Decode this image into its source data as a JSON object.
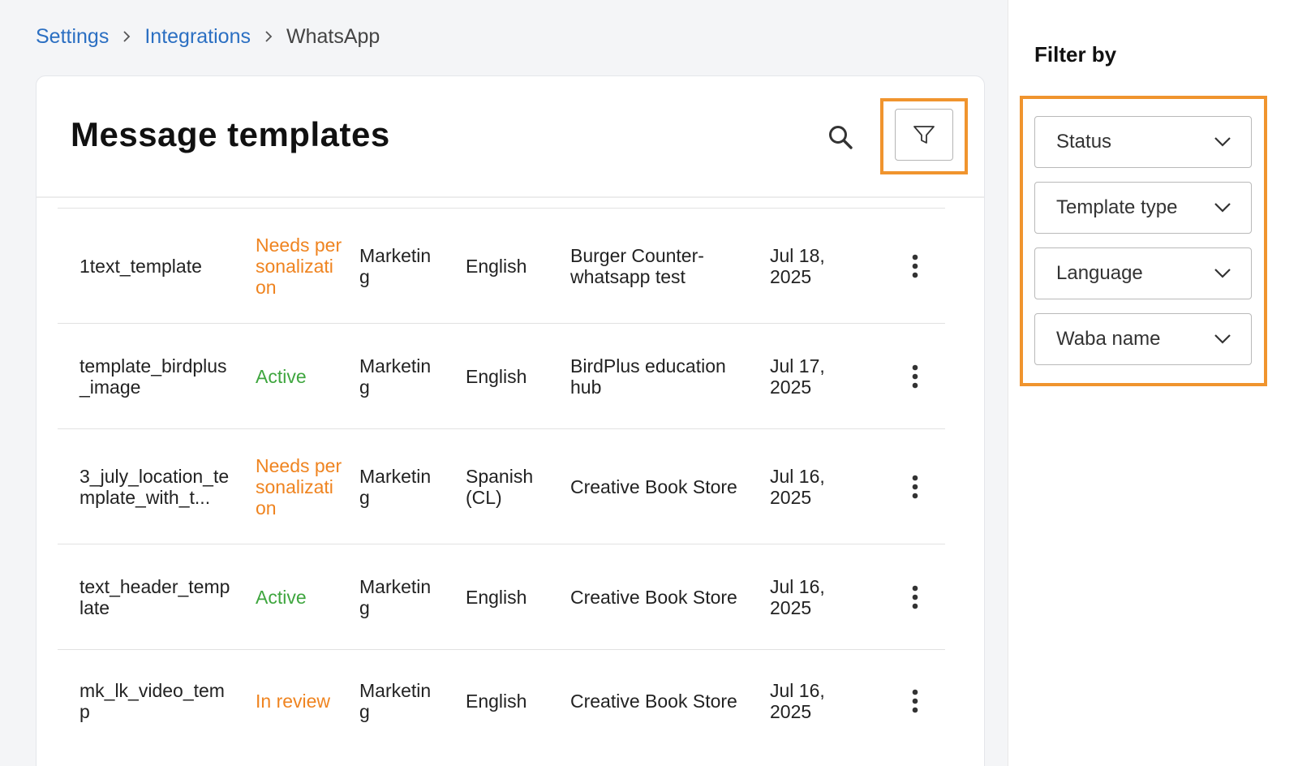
{
  "breadcrumb": {
    "items": [
      "Settings",
      "Integrations"
    ],
    "current": "WhatsApp"
  },
  "header": {
    "title": "Message templates"
  },
  "colors": {
    "accent_highlight": "#f0942e",
    "link": "#2b6fc2",
    "status_needs": "#ef8420",
    "status_active": "#3fa63f",
    "status_review": "#ef8420"
  },
  "icons": {
    "search": "search-icon",
    "filter": "filter-icon",
    "more": "more-vertical-icon",
    "chevron": "chevron-down-icon"
  },
  "rows": [
    {
      "name": "1text_template",
      "status": "Needs personalization",
      "category": "Marketing",
      "language": "English",
      "waba": "Burger Counter-whatsapp test",
      "date": "Jul 18, 2025"
    },
    {
      "name": "template_birdplus_image",
      "status": "Active",
      "category": "Marketing",
      "language": "English",
      "waba": "BirdPlus education hub",
      "date": "Jul 17, 2025"
    },
    {
      "name": "3_july_location_template_with_t...",
      "status": "Needs personalization",
      "category": "Marketing",
      "language": "Spanish (CL)",
      "waba": "Creative Book Store",
      "date": "Jul 16, 2025"
    },
    {
      "name": "text_header_template",
      "status": "Active",
      "category": "Marketing",
      "language": "English",
      "waba": "Creative Book Store",
      "date": "Jul 16, 2025"
    },
    {
      "name": "mk_lk_video_temp",
      "status": "In review",
      "category": "Marketing",
      "language": "English",
      "waba": "Creative Book Store",
      "date": "Jul 16, 2025"
    }
  ],
  "filters": {
    "title": "Filter by",
    "dropdowns": [
      "Status",
      "Template type",
      "Language",
      "Waba name"
    ]
  }
}
